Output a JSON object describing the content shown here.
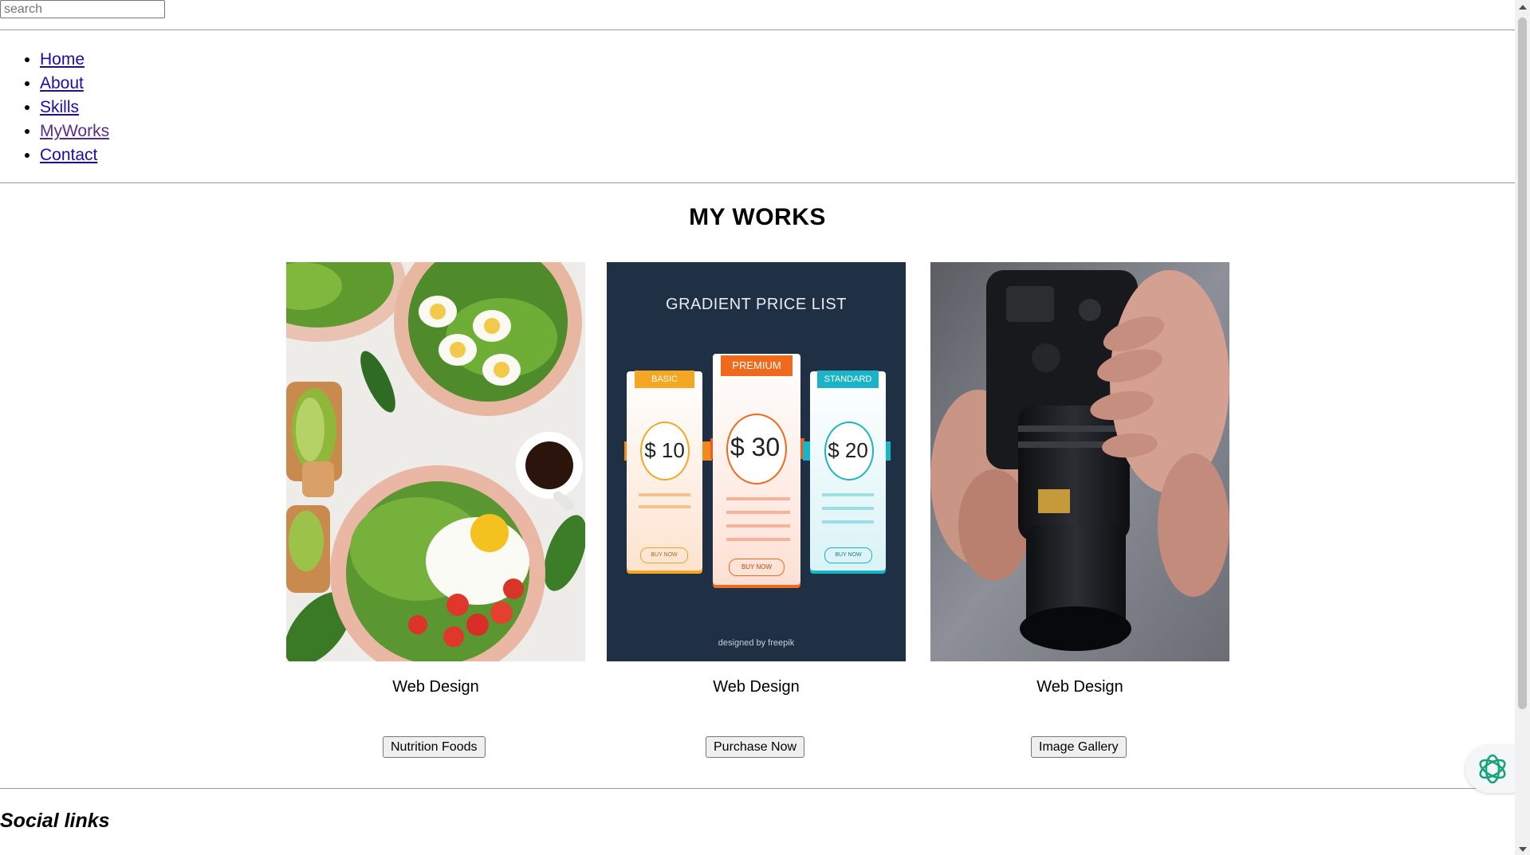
{
  "search": {
    "placeholder": "search"
  },
  "nav": {
    "items": [
      {
        "label": "Home"
      },
      {
        "label": "About"
      },
      {
        "label": "Skills"
      },
      {
        "label": "MyWorks"
      },
      {
        "label": "Contact"
      }
    ]
  },
  "works": {
    "title": "MY WORKS",
    "cards": [
      {
        "image": "food-photo-icon",
        "caption": "Web Design",
        "button_label": "Nutrition Foods"
      },
      {
        "image": "price-list-icon",
        "caption": "Web Design",
        "button_label": "Purchase Now",
        "poster": {
          "heading": "GRADIENT PRICE LIST",
          "plans": [
            {
              "name": "BASIC",
              "price": "$ 10",
              "cta": "BUY NOW"
            },
            {
              "name": "PREMIUM",
              "price": "$ 30",
              "cta": "BUY NOW"
            },
            {
              "name": "STANDARD",
              "price": "$ 20",
              "cta": "BUY NOW"
            }
          ],
          "credit": "designed by freepik"
        }
      },
      {
        "image": "camera-photo-icon",
        "caption": "Web Design",
        "button_label": "Image Gallery"
      }
    ]
  },
  "footer": {
    "social_title": "Social links"
  },
  "colors": {
    "link": "#1a0dab",
    "link_visited": "#5a2b8c",
    "poster_bg": "#1f3045",
    "basic": "#f5a623",
    "premium": "#f06a1d",
    "standard": "#1ab3c7"
  }
}
